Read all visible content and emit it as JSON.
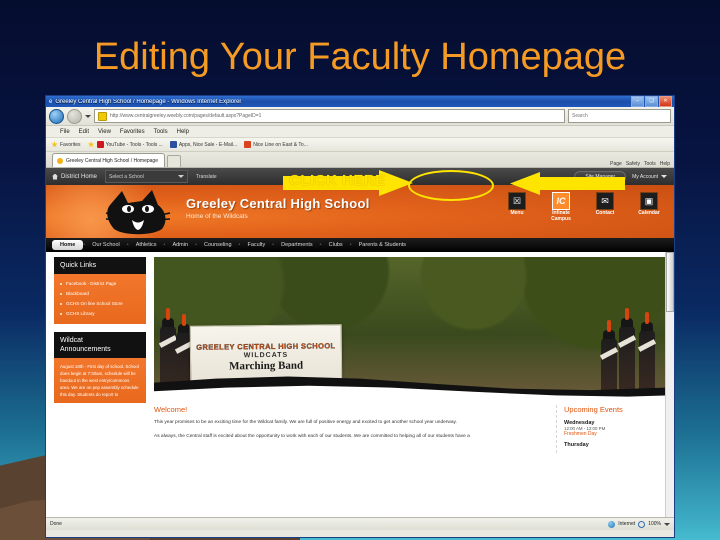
{
  "slide": {
    "title": "Editing Your Faculty Homepage",
    "title_color": "#F59A23",
    "background_colors": [
      "#050d2e",
      "#0a2a63",
      "#46bcd0"
    ]
  },
  "annotations": {
    "click_here_label": "CLICK HERE",
    "highlight_color": "#FFE400",
    "left_arrow_name": "arrow-pointing-right-to-site-manager",
    "right_arrow_name": "arrow-pointing-left-to-my-account",
    "ellipse_target": "Site Manager"
  },
  "browser": {
    "title": "Greeley Central High School / Homepage - Windows Internet Explorer",
    "window_buttons": [
      "–",
      "❑",
      "✕"
    ],
    "address_url": "http://www.centralgreeley.weebly.com/pages/default.aspx?PageID=1",
    "search_placeholder": "Search",
    "menu": [
      "File",
      "Edit",
      "View",
      "Favorites",
      "Tools",
      "Help"
    ],
    "favorites_label": "Favorites",
    "favorite_links": [
      "YouTube - Tools - Tools ...",
      "Apps, Nice Sale - E-Mail...",
      "Nice Line on East & To..."
    ],
    "tab_title": "Greeley Central High School / Homepage",
    "command_bar": [
      "Page",
      "Safety",
      "Tools",
      "Help"
    ],
    "status_text": "Done",
    "zone_label": "Internet",
    "zoom_level": "100%"
  },
  "site": {
    "topnav": {
      "district_home": "District Home",
      "school_select": "Select a School",
      "translate": "Translate",
      "site_manager": "Site Manager",
      "my_account": "My Account"
    },
    "banner": {
      "school_name": "Greeley Central High School",
      "tagline": "Home of the Wildcats",
      "icons": [
        {
          "glyph": "☒",
          "label": "Menu"
        },
        {
          "glyph": "IC",
          "label": "Infinate Campus"
        },
        {
          "glyph": "✉",
          "label": "Contact"
        },
        {
          "glyph": "▣",
          "label": "Calendar"
        }
      ]
    },
    "mainnav": [
      "Home",
      "Our School",
      "Athletics",
      "Admin",
      "Counseling",
      "Faculty",
      "Departments",
      "Clubs",
      "Parents & Students"
    ],
    "quick_links": {
      "heading": "Quick Links",
      "items": [
        "Facebook - District Page",
        "Blackboard",
        "GCHS On line School Store",
        "GCHS Library"
      ]
    },
    "announcements": {
      "heading_line1": "Wildcat",
      "heading_line2": "Announcements",
      "body": "August 18th - First day of school. School does begin at 7:30am, schedule will be handout in the west entry/commons area. We are on pep assembly schedule this day. Students do report to"
    },
    "photo": {
      "banner_line1": "GREELEY CENTRAL HIGH SCHOOL",
      "banner_line2": "WILDCATS",
      "banner_line3": "Marching Band"
    },
    "welcome": {
      "heading": "Welcome!",
      "paragraph1": "This year promises to be an exciting time for the Wildcat family. We are full of positive energy and excited to get another school year underway.",
      "paragraph2": "As always, the Central staff is excited about the opportunity to work with each of our students. We are committed to helping all of our students have a"
    },
    "events": {
      "heading": "Upcoming Events",
      "items": [
        {
          "day": "Wednesday",
          "time": "12:00 AM - 12:00 PM",
          "name": "Freshmen Day"
        },
        {
          "day": "Thursday",
          "time": "",
          "name": ""
        }
      ]
    }
  }
}
